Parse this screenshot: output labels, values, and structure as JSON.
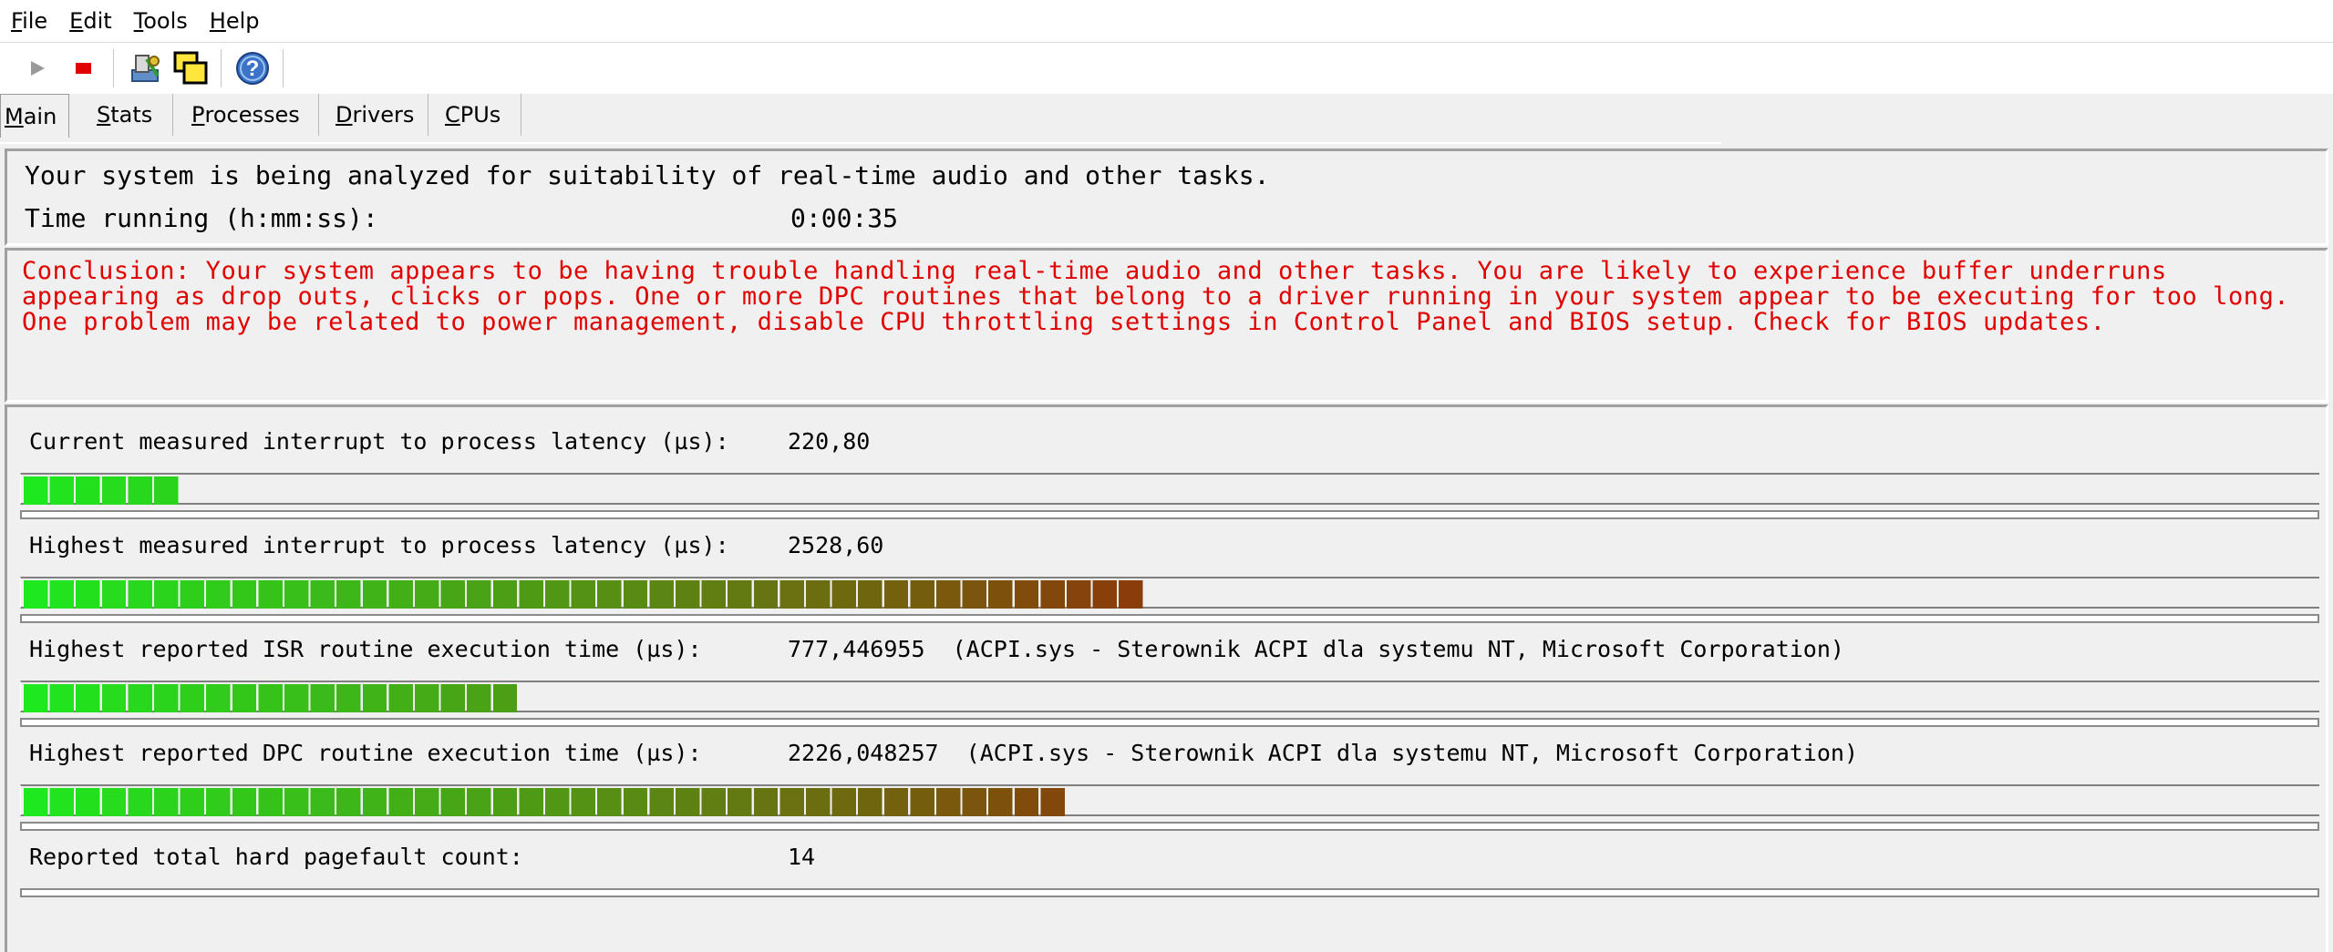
{
  "menu": [
    {
      "accel": "F",
      "rest": "ile"
    },
    {
      "accel": "E",
      "rest": "dit"
    },
    {
      "accel": "T",
      "rest": "ools"
    },
    {
      "accel": "H",
      "rest": "elp"
    }
  ],
  "toolbar": {
    "buttons": [
      "play-icon",
      "stop-icon",
      "settings-icon",
      "windows-icon",
      "help-icon"
    ]
  },
  "tabs": [
    {
      "accel": "M",
      "rest": "ain",
      "active": true
    },
    {
      "accel": "S",
      "rest": "tats",
      "active": false
    },
    {
      "accel": "P",
      "rest": "rocesses",
      "active": false
    },
    {
      "accel": "D",
      "rest": "rivers",
      "active": false
    },
    {
      "accel": "C",
      "rest": "PUs",
      "active": false
    }
  ],
  "status": {
    "analyzing": "Your system is being analyzed for suitability of real-time audio and other tasks.",
    "time_label": "Time running (h:mm:ss):",
    "time_value": "0:00:35"
  },
  "conclusion": "Conclusion: Your system appears to be having trouble handling real-time audio and other tasks. You are likely to experience buffer underruns appearing as drop outs, clicks or pops. One or more DPC routines that belong to a driver running in your system appear to be executing for too long. One problem may be related to power management, disable CPU throttling settings in Control Panel and BIOS setup. Check for BIOS updates.",
  "metrics": [
    {
      "label": "Current measured interrupt to process latency (µs):",
      "value": "220,80",
      "segments": 6
    },
    {
      "label": "Highest measured interrupt to process latency (µs):",
      "value": "2528,60",
      "segments": 43
    },
    {
      "label": "Highest reported ISR routine execution time (µs):",
      "value": "777,446955  (ACPI.sys - Sterownik ACPI dla systemu NT, Microsoft Corporation)",
      "segments": 19
    },
    {
      "label": "Highest reported DPC routine execution time (µs):",
      "value": "2226,048257  (ACPI.sys - Sterownik ACPI dla systemu NT, Microsoft Corporation)",
      "segments": 40
    },
    {
      "label": "Reported total hard pagefault count:",
      "value": "14",
      "segments": 0
    }
  ],
  "colors": {
    "bar_start": "#1ee81e",
    "bar_end": "#8a3c0a",
    "conclusion_text": "#e00000"
  }
}
